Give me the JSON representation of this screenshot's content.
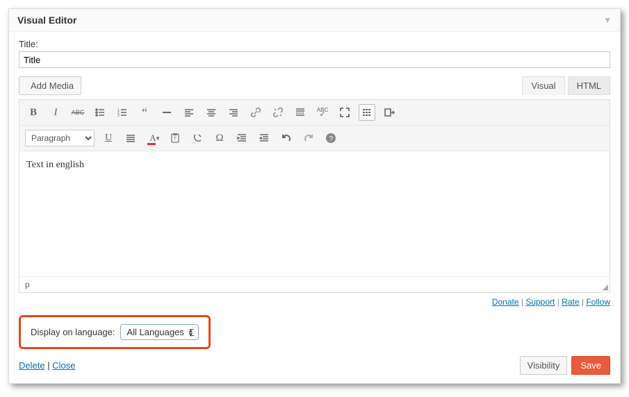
{
  "panel": {
    "title": "Visual Editor"
  },
  "title": {
    "label": "Title:",
    "value": "Title"
  },
  "add_media": {
    "label": "Add Media"
  },
  "tabs": {
    "visual": "Visual",
    "html": "HTML",
    "active": "visual"
  },
  "toolbar": {
    "row1": {
      "bold": "B",
      "italic": "I",
      "abc": "ABC"
    },
    "format_select": "Paragraph",
    "underline": "U",
    "textcolor": "A"
  },
  "editor": {
    "content": "Text in english",
    "status_path": "p"
  },
  "footer_links": {
    "donate": "Donate",
    "support": "Support",
    "rate": "Rate",
    "follow": "Follow",
    "sep": " | "
  },
  "language_box": {
    "label": "Display on language:",
    "selected": "All Languages"
  },
  "bottom": {
    "delete": "Delete",
    "close": "Close",
    "sep": " | ",
    "visibility": "Visibility",
    "save": "Save"
  }
}
